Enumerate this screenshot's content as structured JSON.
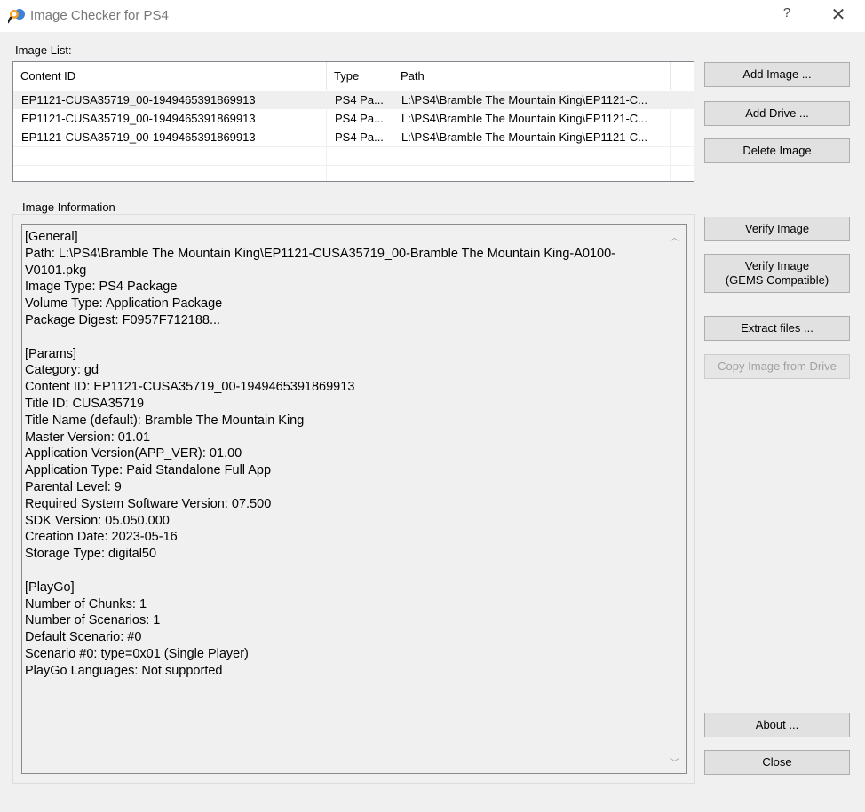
{
  "window": {
    "title": "Image Checker for PS4",
    "help_glyph": "?",
    "close_glyph": "✕"
  },
  "image_list": {
    "label": "Image List:",
    "columns": [
      "Content ID",
      "Type",
      "Path"
    ],
    "rows": [
      {
        "content_id": "EP1121-CUSA35719_00-1949465391869913",
        "type": "PS4 Pa...",
        "path": "L:\\PS4\\Bramble The Mountain King\\EP1121-C..."
      },
      {
        "content_id": "EP1121-CUSA35719_00-1949465391869913",
        "type": "PS4 Pa...",
        "path": "L:\\PS4\\Bramble The Mountain King\\EP1121-C..."
      },
      {
        "content_id": "EP1121-CUSA35719_00-1949465391869913",
        "type": "PS4 Pa...",
        "path": "L:\\PS4\\Bramble The Mountain King\\EP1121-C..."
      }
    ]
  },
  "buttons": {
    "add_image": "Add Image ...",
    "add_drive": "Add Drive ...",
    "delete_image": "Delete Image",
    "verify_image": "Verify Image",
    "verify_gems_line1": "Verify Image",
    "verify_gems_line2": "(GEMS Compatible)",
    "extract_files": "Extract files ...",
    "copy_image": "Copy Image from Drive",
    "about": "About ...",
    "close": "Close"
  },
  "image_information": {
    "label": "Image Information",
    "text": "[General]\nPath: L:\\PS4\\Bramble The Mountain King\\EP1121-CUSA35719_00-Bramble The Mountain King-A0100-V0101.pkg\nImage Type: PS4 Package\nVolume Type: Application Package\nPackage Digest: F0957F712188...\n\n[Params]\nCategory: gd\nContent ID: EP1121-CUSA35719_00-1949465391869913\nTitle ID: CUSA35719\nTitle Name (default): Bramble The Mountain King\nMaster Version: 01.01\nApplication Version(APP_VER): 01.00\nApplication Type: Paid Standalone Full App\nParental Level: 9\nRequired System Software Version: 07.500\nSDK Version: 05.050.000\nCreation Date: 2023-05-16\nStorage Type: digital50\n\n[PlayGo]\nNumber of Chunks: 1\nNumber of Scenarios: 1\nDefault Scenario: #0\nScenario #0: type=0x01 (Single Player)\nPlayGo Languages: Not supported",
    "scroll_up_glyph": "︿",
    "scroll_down_glyph": "﹀"
  }
}
